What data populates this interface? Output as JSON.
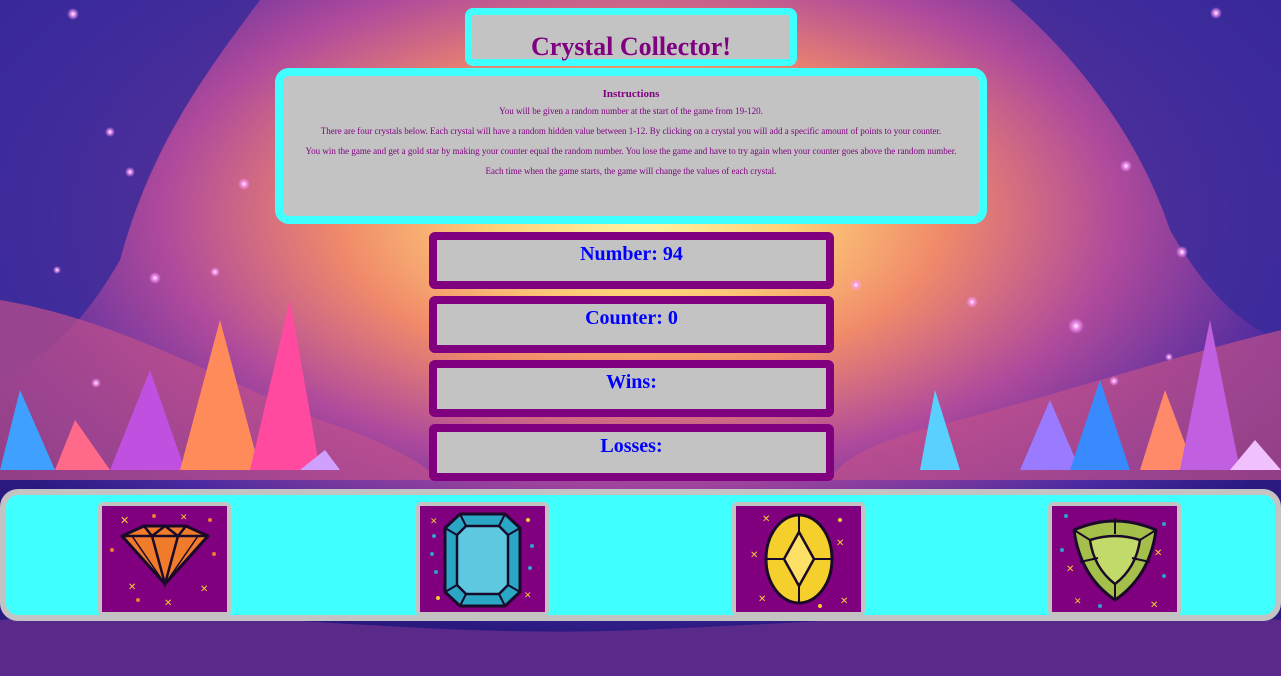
{
  "game": {
    "title": "Crystal Collector!"
  },
  "instructions": {
    "heading": "Instructions",
    "lines": [
      "You will be given a random number at the start of the game from 19-120.",
      "There are four crystals below. Each crystal will have a random hidden value between 1-12. By clicking on a crystal you will add a specific amount of points to your counter.",
      "You win the game and get a gold star by making your counter equal the random number. You lose the game and have to try again when your counter goes above the random number.",
      "Each time when the game starts, the game will change the values of each crystal."
    ]
  },
  "stats": {
    "number_text": "Number: 94",
    "counter_text": "Counter: 0",
    "wins_text": "Wins:",
    "losses_text": "Losses:"
  },
  "crystals": [
    {
      "icon": "orange-diamond-icon",
      "color": "#f07b2a"
    },
    {
      "icon": "blue-emerald-cut-gem-icon",
      "color": "#29a7c5"
    },
    {
      "icon": "yellow-oval-gem-icon",
      "color": "#f5cf2b"
    },
    {
      "icon": "green-trillion-gem-icon",
      "color": "#a4c04a"
    }
  ],
  "colors": {
    "panel_gray": "#c3c3c3",
    "cyan_accent": "#40ffff",
    "purple_accent": "#800080",
    "stat_text_blue": "#0000ff"
  }
}
